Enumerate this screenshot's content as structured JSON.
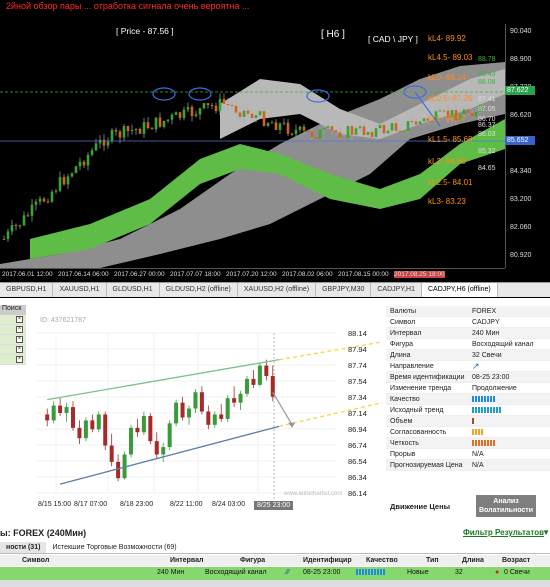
{
  "mt4": {
    "header": "2йной обзор пары ... отработка сигнала очень вероятна ...",
    "price_label": "[ Price - 87.56 ]",
    "timeframe": "[ H6 ]",
    "symbol": "[ CAD \\ JPY ]",
    "levels": [
      {
        "label": "kL4- 89.92",
        "color": "#ff8c1a",
        "side": "88.78"
      },
      {
        "label": "kL4.5- 89.03",
        "color": "#ff8c1a",
        "side": "88.43"
      },
      {
        "label": "kL0- 88.14",
        "color": "#ff8c1a",
        "side": "88.08"
      },
      {
        "label": "kL0.5- 87.36",
        "color": "#ff8c1a",
        "side": "87.41"
      },
      {
        "label": "kL1- 86.57",
        "color": "#ff8c1a",
        "side": "86.70"
      },
      {
        "label": "kL1.5- 85.68",
        "color": "#ff8c1a",
        "side": "86.03"
      },
      {
        "label": "kL2- 84.80",
        "color": "#ff8c1a",
        "side": "85.32"
      },
      {
        "label": "kL2.5- 84.01",
        "color": "#ff8c1a",
        "side": "84.65"
      },
      {
        "label": "kL3- 83.23",
        "color": "#ff8c1a",
        "side": ""
      }
    ],
    "right_ticks": [
      "88.78",
      "88.43",
      "88.08",
      "87.41",
      "87.05",
      "86.70",
      "86.37",
      "86.03",
      "85.32",
      "84.65"
    ],
    "axis_ticks": [
      "90.040",
      "88.900",
      "87.720",
      "86.620",
      "85.450",
      "84.340",
      "83.200",
      "82.060",
      "80.920"
    ],
    "price_marker": "87.622",
    "price_marker2": "85.652",
    "time_labels": [
      "2017.06.01 12:00",
      "2017.06.14 06:00",
      "2017.06.27 00:00",
      "2017.07.07 18:00",
      "2017.07.20 12:00",
      "2017.08.02 06:00",
      "2017.08.15 00:00",
      "2017.08.25 18:00"
    ],
    "tabs": [
      "GBPUSD,H1",
      "XAUUSD,H1",
      "GLDUSD,H1",
      "GLDUSD,H2 (offline)",
      "XAUUSD,H2 (offline)",
      "GBPJPY,M30",
      "CADJPY,H1",
      "CADJPY,H6 (offline)"
    ]
  },
  "left_panel": {
    "header": "Поиск",
    "rows": [
      "",
      "",
      "",
      "",
      ""
    ]
  },
  "chart": {
    "id": "ID: 437621787",
    "watermark": "www.autochartist.com",
    "yticks": [
      "88.14",
      "87.94",
      "87.74",
      "87.54",
      "87.34",
      "87.14",
      "86.94",
      "86.74",
      "86.54",
      "86.34",
      "86.14"
    ],
    "xticks": [
      "8/15 15:00",
      "8/17 07:00",
      "8/18 23:00",
      "8/22 11:00",
      "8/24 03:00",
      "8/25 23:00"
    ]
  },
  "chart_data": {
    "type": "candlestick",
    "title": "",
    "ylim": [
      86.04,
      88.2
    ],
    "ohlc": [
      [
        87.1,
        87.18,
        86.94,
        87.02
      ],
      [
        87.02,
        87.28,
        86.98,
        87.22
      ],
      [
        87.22,
        87.32,
        87.08,
        87.12
      ],
      [
        87.12,
        87.26,
        87.0,
        87.2
      ],
      [
        87.2,
        87.28,
        86.88,
        86.92
      ],
      [
        86.92,
        87.02,
        86.7,
        86.78
      ],
      [
        86.78,
        87.06,
        86.74,
        87.02
      ],
      [
        87.02,
        87.1,
        86.86,
        86.9
      ],
      [
        86.9,
        87.14,
        86.86,
        87.1
      ],
      [
        87.1,
        87.14,
        86.62,
        86.68
      ],
      [
        86.68,
        86.84,
        86.4,
        86.46
      ],
      [
        86.46,
        86.56,
        86.2,
        86.24
      ],
      [
        86.24,
        86.6,
        86.22,
        86.56
      ],
      [
        86.56,
        86.96,
        86.52,
        86.92
      ],
      [
        86.92,
        87.04,
        86.8,
        86.86
      ],
      [
        86.86,
        87.14,
        86.82,
        87.08
      ],
      [
        87.08,
        87.12,
        86.7,
        86.74
      ],
      [
        86.74,
        86.86,
        86.5,
        86.56
      ],
      [
        86.56,
        86.72,
        86.46,
        86.66
      ],
      [
        86.66,
        87.02,
        86.62,
        86.98
      ],
      [
        86.98,
        87.3,
        86.94,
        87.26
      ],
      [
        87.26,
        87.34,
        87.02,
        87.06
      ],
      [
        87.06,
        87.22,
        86.96,
        87.18
      ],
      [
        87.18,
        87.44,
        87.12,
        87.4
      ],
      [
        87.4,
        87.48,
        87.1,
        87.14
      ],
      [
        87.14,
        87.22,
        86.9,
        86.96
      ],
      [
        86.96,
        87.14,
        86.92,
        87.1
      ],
      [
        87.1,
        87.24,
        87.0,
        87.04
      ],
      [
        87.04,
        87.36,
        87.0,
        87.32
      ],
      [
        87.32,
        87.48,
        87.2,
        87.26
      ],
      [
        87.26,
        87.42,
        87.16,
        87.38
      ],
      [
        87.38,
        87.62,
        87.34,
        87.58
      ],
      [
        87.58,
        87.7,
        87.46,
        87.5
      ],
      [
        87.5,
        87.8,
        87.48,
        87.76
      ],
      [
        87.76,
        87.84,
        87.56,
        87.62
      ],
      [
        87.62,
        87.76,
        87.28,
        87.34
      ]
    ],
    "channel_upper": [
      [
        0,
        87.3
      ],
      [
        36,
        87.84
      ]
    ],
    "channel_lower": [
      [
        2,
        86.16
      ],
      [
        36,
        86.94
      ]
    ],
    "projection_upper": [
      [
        36,
        87.84
      ],
      [
        56,
        88.14
      ]
    ],
    "projection_lower": [
      [
        36,
        86.94
      ],
      [
        56,
        87.34
      ]
    ]
  },
  "info": {
    "rows": [
      {
        "k": "Валюты",
        "v": "FOREX"
      },
      {
        "k": "Символ",
        "v": "CADJPY"
      },
      {
        "k": "Интервал",
        "v": "240 Мин"
      },
      {
        "k": "Фигура",
        "v": "Восходящий канал"
      },
      {
        "k": "Длина",
        "v": "32 Свечи"
      },
      {
        "k": "Направление",
        "v": "",
        "icon": "up-arrow-icon"
      },
      {
        "k": "Время идентификации",
        "v": "08-25 23:00"
      },
      {
        "k": "Изменение тренда",
        "v": "Продолжение"
      },
      {
        "k": "Качество",
        "v": "",
        "bars": {
          "color": "#1e8be6",
          "n": 8
        }
      },
      {
        "k": "Исходный тренд",
        "v": "",
        "bars": {
          "color": "#1aa0c8",
          "n": 10
        }
      },
      {
        "k": "Объем",
        "v": "",
        "bars": {
          "color": "#8b5a2b",
          "n": 1
        }
      },
      {
        "k": "Согласованность",
        "v": "",
        "bars": {
          "color": "#f0a020",
          "n": 4
        }
      },
      {
        "k": "Четкость",
        "v": "",
        "bars": {
          "color": "#e07020",
          "n": 8
        }
      },
      {
        "k": "Прорыв",
        "v": "N/A"
      },
      {
        "k": "Прогнозируемая Цена",
        "v": "N/A"
      }
    ],
    "bottom_label": "Движение Цены",
    "button": "Анализ Волатильности"
  },
  "results": {
    "title": "ы: FOREX (240Мин)",
    "filter": "Фильтр Результатов",
    "tabs": [
      "ности (31)",
      "Истекшие Торговые Возможности (69)"
    ],
    "headers": [
      "Символ",
      "Интервал",
      "Фигура",
      "Идентифицир",
      "Качество",
      "Тип",
      "Длина",
      "Возраст"
    ],
    "row": [
      "",
      "240 Мин",
      "Восходящий канал",
      "",
      "08-25 23:00",
      "",
      "Новые",
      "32",
      "0 Свечи"
    ]
  }
}
